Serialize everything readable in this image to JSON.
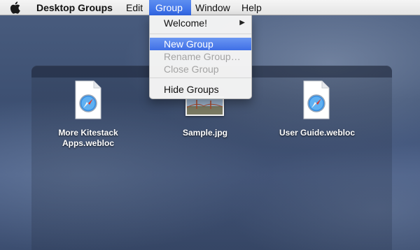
{
  "menubar": {
    "apple_icon": "apple-logo-icon",
    "app_name": "Desktop Groups",
    "items": [
      "Edit",
      "Group",
      "Window",
      "Help"
    ],
    "active_item": "Group"
  },
  "group_menu": {
    "welcome": "Welcome!",
    "submenu_arrow": "▶",
    "new_group": "New Group",
    "rename_group": "Rename Group…",
    "close_group": "Close Group",
    "hide_groups": "Hide Groups",
    "highlight_color": "#3f6fe6",
    "disabled_color": "#a4a4a4"
  },
  "group_panel": {
    "files": [
      {
        "label_line1": "More Kitestack",
        "label_line2": "Apps.webloc",
        "icon": "safari-webloc-icon"
      },
      {
        "label_line1": "Sample.jpg",
        "label_line2": "",
        "icon": "image-thumbnail-icon"
      },
      {
        "label_line1": "User Guide.webloc",
        "label_line2": "",
        "icon": "safari-webloc-icon"
      }
    ]
  }
}
